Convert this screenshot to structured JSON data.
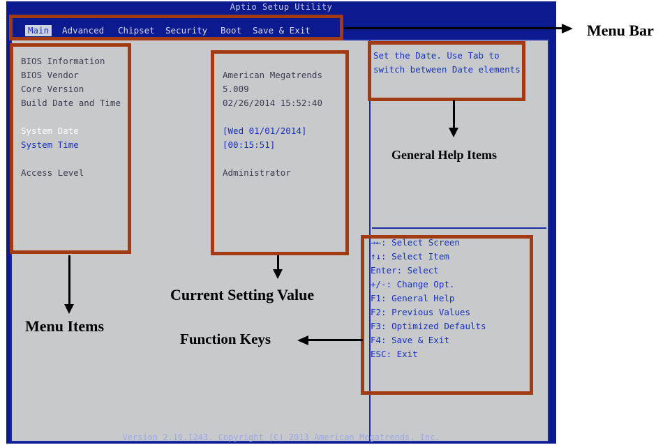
{
  "title": "Aptio Setup Utility",
  "menu": [
    "Main",
    "Advanced",
    "Chipset",
    "Security",
    "Boot",
    "Save & Exit"
  ],
  "active_menu": "Main",
  "main": {
    "rows": [
      {
        "label": "BIOS Information",
        "value": ""
      },
      {
        "label": "BIOS Vendor",
        "value": "American Megatrends"
      },
      {
        "label": "Core Version",
        "value": "5.009"
      },
      {
        "label": "Build Date and Time",
        "value": "02/26/2014 15:52:40"
      },
      {
        "label": "System Date",
        "value": "[Wed 01/01/2014]"
      },
      {
        "label": "System Time",
        "value": "[00:15:51]"
      },
      {
        "label": "Access Level",
        "value": "Administrator"
      }
    ]
  },
  "help": {
    "line1": "Set the Date. Use Tab to",
    "line2": "switch between Date elements."
  },
  "function_keys": [
    "→←: Select Screen",
    "↑↓: Select Item",
    "Enter: Select",
    "+/-: Change Opt.",
    "F1: General Help",
    "F2: Previous Values",
    "F3: Optimized Defaults",
    "F4: Save & Exit",
    "ESC: Exit"
  ],
  "footer": "Version 2.16.1243. Copyright (C) 2013 American Megatrends, Inc.",
  "annotations": {
    "menu_bar": "Menu Bar",
    "menu_items": "Menu Items",
    "current_setting_value": "Current Setting Value",
    "general_help_items": "General Help Items",
    "function_keys": "Function Keys"
  },
  "colors": {
    "bios_blue": "#0b1a8f",
    "panel_gray": "#c8c9cb",
    "highlight_blue": "#1530c0",
    "annotation_box": "#a23b14"
  }
}
